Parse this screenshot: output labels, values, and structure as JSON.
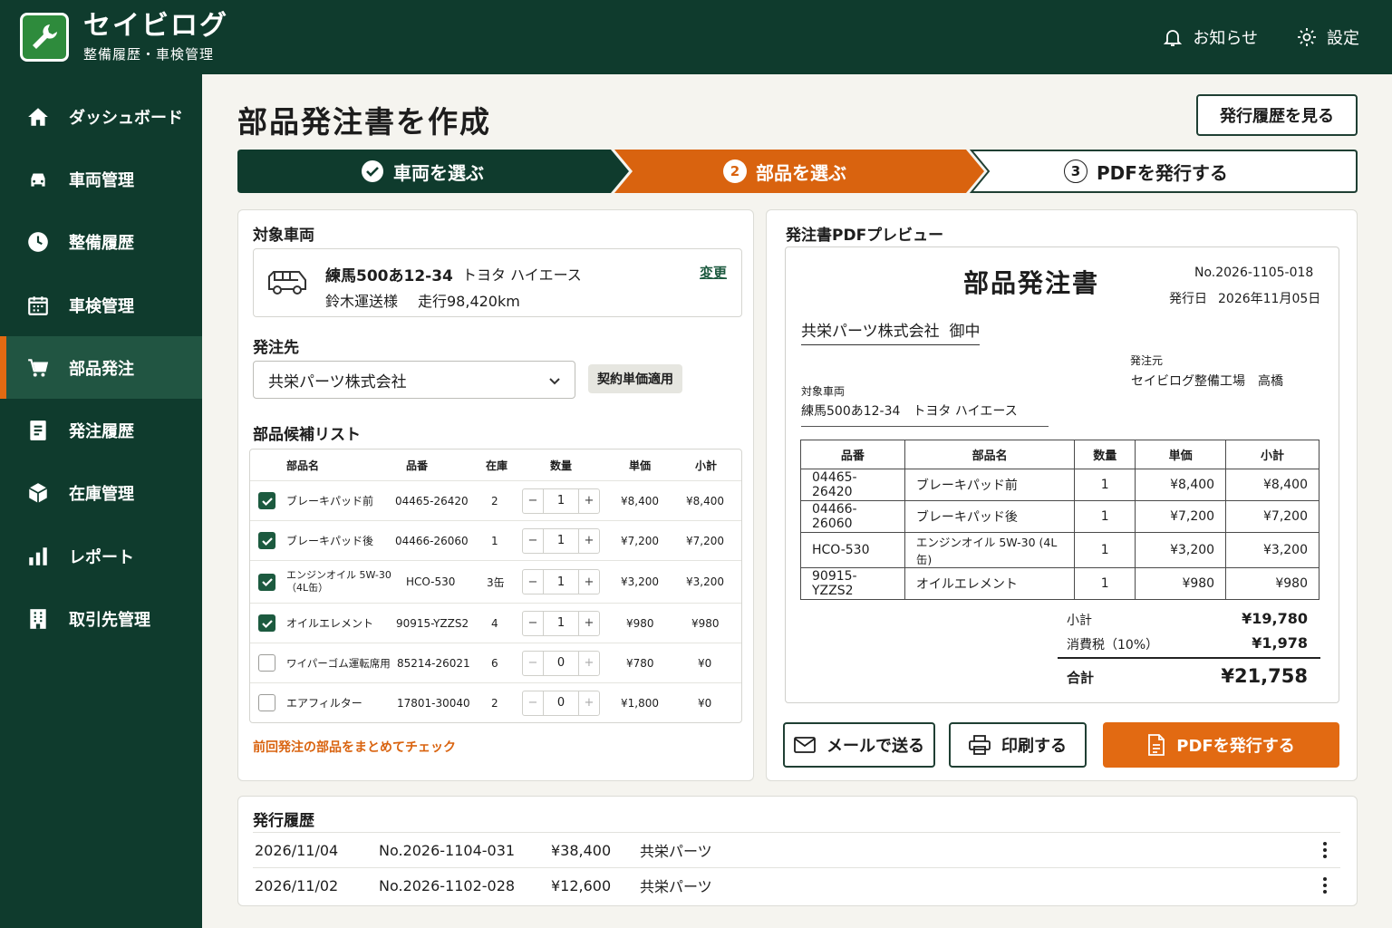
{
  "brand": {
    "name": "セイビログ",
    "subtitle": "整備履歴・車検管理"
  },
  "topbar": {
    "notifications": "お知らせ",
    "settings": "設定"
  },
  "sidebar": {
    "items": [
      {
        "label": "ダッシュボード",
        "icon": "home-icon"
      },
      {
        "label": "車両管理",
        "icon": "car-icon"
      },
      {
        "label": "整備履歴",
        "icon": "clock-icon"
      },
      {
        "label": "車検管理",
        "icon": "calendar-icon"
      },
      {
        "label": "部品発注",
        "icon": "cart-icon",
        "active": true
      },
      {
        "label": "発注履歴",
        "icon": "document-icon"
      },
      {
        "label": "在庫管理",
        "icon": "box-icon"
      },
      {
        "label": "レポート",
        "icon": "bar-chart-icon"
      },
      {
        "label": "取引先管理",
        "icon": "building-icon"
      }
    ]
  },
  "page": {
    "title": "部品発注書を作成",
    "history_button": "発行履歴を見る"
  },
  "stepper": {
    "steps": [
      {
        "number": "✓",
        "label": "車両を選ぶ",
        "state": "done"
      },
      {
        "number": "2",
        "label": "部品を選ぶ",
        "state": "current"
      },
      {
        "number": "3",
        "label": "PDFを発行する",
        "state": "todo"
      }
    ]
  },
  "vehicle": {
    "section_title": "対象車両",
    "plate": "練馬500あ12-34",
    "model": "トヨタ ハイエース",
    "owner": "鈴木運送様",
    "mileage": "走行98,420km",
    "change_link": "変更"
  },
  "supplier": {
    "section_title": "発注先",
    "selected": "共栄パーツ株式会社",
    "badge": "契約単価適用"
  },
  "parts": {
    "section_title": "部品候補リスト",
    "headers": {
      "name": "部品名",
      "part_no": "品番",
      "stock": "在庫",
      "qty": "数量",
      "unit_price": "単価",
      "subtotal": "小計"
    },
    "rows": [
      {
        "checked": true,
        "name": "ブレーキパッド前",
        "name2": "",
        "part_no": "04465-26420",
        "stock": "2",
        "qty": "1",
        "unit_price": "¥8,400",
        "subtotal": "¥8,400"
      },
      {
        "checked": true,
        "name": "ブレーキパッド後",
        "name2": "",
        "part_no": "04466-26060",
        "stock": "1",
        "qty": "1",
        "unit_price": "¥7,200",
        "subtotal": "¥7,200"
      },
      {
        "checked": true,
        "name": "エンジンオイル 5W-30",
        "name2": "（4L缶）",
        "part_no": "HCO-530",
        "stock": "3缶",
        "qty": "1",
        "unit_price": "¥3,200",
        "subtotal": "¥3,200"
      },
      {
        "checked": true,
        "name": "オイルエレメント",
        "name2": "",
        "part_no": "90915-YZZS2",
        "stock": "4",
        "qty": "1",
        "unit_price": "¥980",
        "subtotal": "¥980"
      },
      {
        "checked": false,
        "name": "ワイパーゴム運転席用",
        "name2": "",
        "part_no": "85214-26021",
        "stock": "6",
        "qty": "0",
        "unit_price": "¥780",
        "subtotal": "¥0"
      },
      {
        "checked": false,
        "name": "エアフィルター",
        "name2": "",
        "part_no": "17801-30040",
        "stock": "2",
        "qty": "0",
        "unit_price": "¥1,800",
        "subtotal": "¥0"
      }
    ],
    "bulk_check_link": "前回発注の部品をまとめてチェック"
  },
  "preview": {
    "section_title": "発注書PDFプレビュー",
    "doc_title": "部品発注書",
    "doc_no": "No.2026-1105-018",
    "issue_label": "発行日",
    "issue_date": "2026年11月05日",
    "addressee": "共栄パーツ株式会社  御中",
    "issuer_label": "発注元",
    "issuer": "セイビログ整備工場　高橋",
    "vehicle_label": "対象車両",
    "vehicle": "練馬500あ12-34　トヨタ ハイエース",
    "table_headers": {
      "part_no": "品番",
      "name": "部品名",
      "qty": "数量",
      "unit_price": "単価",
      "subtotal": "小計"
    },
    "table_rows": [
      {
        "part_no": "04465-26420",
        "name": "ブレーキパッド前",
        "qty": "1",
        "unit_price": "¥8,400",
        "subtotal": "¥8,400"
      },
      {
        "part_no": "04466-26060",
        "name": "ブレーキパッド後",
        "qty": "1",
        "unit_price": "¥7,200",
        "subtotal": "¥7,200"
      },
      {
        "part_no": "HCO-530",
        "name": "エンジンオイル 5W-30 (4L缶)",
        "qty": "1",
        "unit_price": "¥3,200",
        "subtotal": "¥3,200"
      },
      {
        "part_no": "90915-YZZS2",
        "name": "オイルエレメント",
        "qty": "1",
        "unit_price": "¥980",
        "subtotal": "¥980"
      }
    ],
    "subtotal_label": "小計",
    "subtotal": "¥19,780",
    "tax_label": "消費税（10%）",
    "tax": "¥1,978",
    "total_label": "合計",
    "total": "¥21,758"
  },
  "actions": {
    "email": "メールで送る",
    "print": "印刷する",
    "issue_pdf": "PDFを発行する"
  },
  "history": {
    "section_title": "発行履歴",
    "rows": [
      {
        "date": "2026/11/04",
        "no": "No.2026-1104-031",
        "amount": "¥38,400",
        "supplier": "共栄パーツ"
      },
      {
        "date": "2026/11/02",
        "no": "No.2026-1102-028",
        "amount": "¥12,600",
        "supplier": "共栄パーツ"
      }
    ]
  },
  "colors": {
    "primary": "#0f3b2d",
    "accent": "#e26a12",
    "check": "#1c5a3f"
  }
}
